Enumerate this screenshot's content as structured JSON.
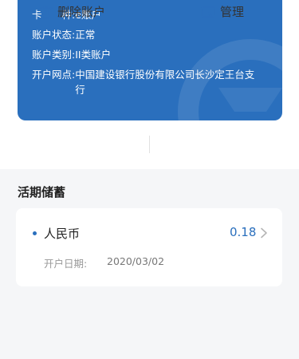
{
  "account_card": {
    "rows": [
      {
        "label": "卡　　种: ",
        "value": "e账户"
      },
      {
        "label": "账户状态: ",
        "value": "正常"
      },
      {
        "label": "账户类别: ",
        "value": "II类账户"
      },
      {
        "label": "开户网点: ",
        "value": "中国建设银行股份有限公司长沙定王台支行"
      }
    ]
  },
  "actions": {
    "delete_label": "删除账户",
    "manage_label": "管理"
  },
  "section": {
    "title": "活期储蓄"
  },
  "deposit": {
    "currency": "人民币",
    "balance": "0.18",
    "open_date_label": "开户日期:",
    "open_date": "2020/03/02"
  },
  "colors": {
    "brand_blue": "#2a6fbd",
    "background": "#f5f6f8"
  }
}
